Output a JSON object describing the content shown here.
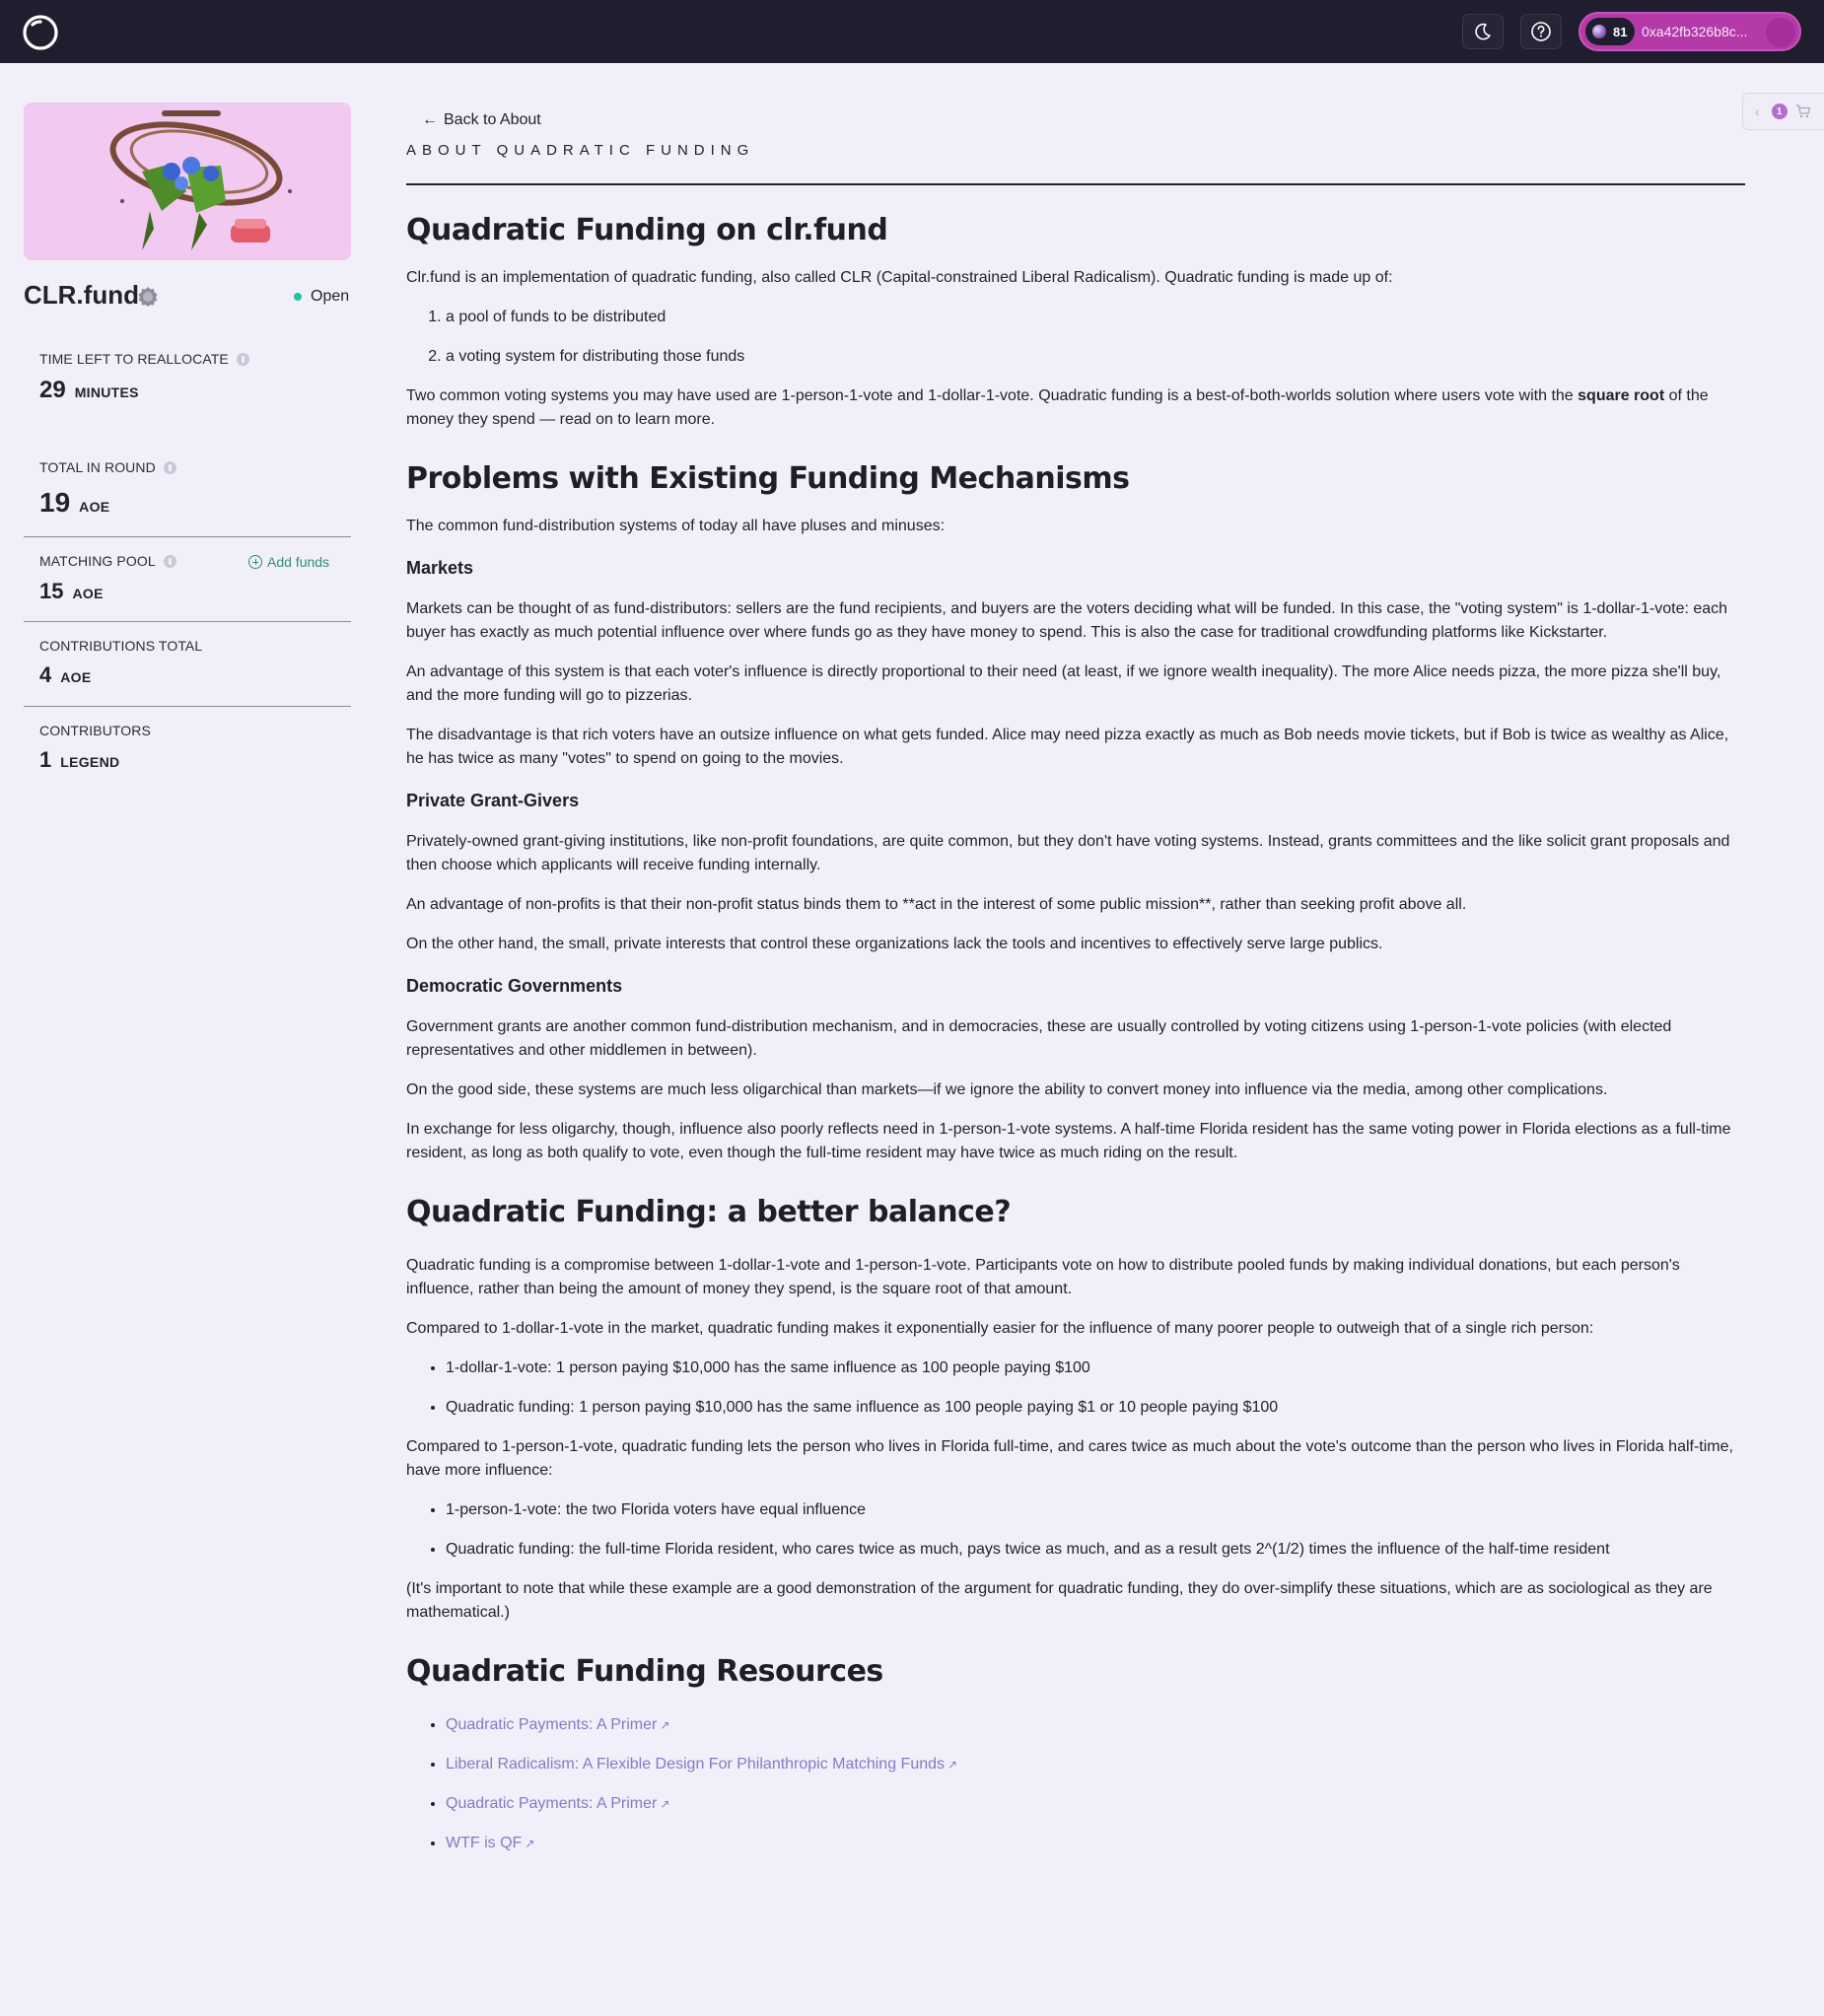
{
  "header": {
    "wallet_count": "81",
    "wallet_address": "0xa42fb326b8c..."
  },
  "sidebar": {
    "round_name": "CLR.fund",
    "status": "Open",
    "stats": {
      "time_left": {
        "label": "TIME LEFT TO REALLOCATE",
        "value": "29",
        "unit": "MINUTES"
      },
      "total_in_round": {
        "label": "TOTAL IN ROUND",
        "value": "19",
        "unit": "AOE"
      },
      "matching_pool": {
        "label": "MATCHING POOL",
        "value": "15",
        "unit": "AOE",
        "action": "Add funds"
      },
      "contributions_total": {
        "label": "CONTRIBUTIONS TOTAL",
        "value": "4",
        "unit": "AOE"
      },
      "contributors": {
        "label": "CONTRIBUTORS",
        "value": "1",
        "unit": "LEGEND"
      }
    }
  },
  "cart": {
    "badge": "1"
  },
  "main": {
    "back_link": "Back to About",
    "eyebrow": "ABOUT QUADRATIC FUNDING",
    "section1": {
      "heading": "Quadratic Funding on clr.fund",
      "intro": "Clr.fund is an implementation of quadratic funding, also called CLR (Capital-constrained Liberal Radicalism). Quadratic funding is made up of:",
      "list": [
        "a pool of funds to be distributed",
        "a voting system for distributing those funds"
      ],
      "p2_before": "Two common voting systems you may have used are 1-person-1-vote and 1-dollar-1-vote. Quadratic funding is a best-of-both-worlds solution where users vote with the ",
      "p2_bold": "square root",
      "p2_after": " of the money they spend — read on to learn more."
    },
    "section2": {
      "heading": "Problems with Existing Funding Mechanisms",
      "intro": "The common fund-distribution systems of today all have pluses and minuses:",
      "markets": {
        "heading": "Markets",
        "p1": "Markets can be thought of as fund-distributors: sellers are the fund recipients, and buyers are the voters deciding what will be funded. In this case, the \"voting system\" is 1-dollar-1-vote: each buyer has exactly as much potential influence over where funds go as they have money to spend. This is also the case for traditional crowdfunding platforms like Kickstarter.",
        "p2": "An advantage of this system is that each voter's influence is directly proportional to their need (at least, if we ignore wealth inequality). The more Alice needs pizza, the more pizza she'll buy, and the more funding will go to pizzerias.",
        "p3": "The disadvantage is that rich voters have an outsize influence on what gets funded. Alice may need pizza exactly as much as Bob needs movie tickets, but if Bob is twice as wealthy as Alice, he has twice as many \"votes\" to spend on going to the movies."
      },
      "private": {
        "heading": "Private Grant-Givers",
        "p1": "Privately-owned grant-giving institutions, like non-profit foundations, are quite common, but they don't have voting systems. Instead, grants committees and the like solicit grant proposals and then choose which applicants will receive funding internally.",
        "p2": "An advantage of non-profits is that their non-profit status binds them to **act in the interest of some public mission**, rather than seeking profit above all.",
        "p3": "On the other hand, the small, private interests that control these organizations lack the tools and incentives to effectively serve large publics."
      },
      "democratic": {
        "heading": "Democratic Governments",
        "p1": "Government grants are another common fund-distribution mechanism, and in democracies, these are usually controlled by voting citizens using 1-person-1-vote policies (with elected representatives and other middlemen in between).",
        "p2": "On the good side, these systems are much less oligarchical than markets—if we ignore the ability to convert money into influence via the media, among other complications.",
        "p3": "In exchange for less oligarchy, though, influence also poorly reflects need in 1-person-1-vote systems. A half-time Florida resident has the same voting power in Florida elections as a full-time resident, as long as both qualify to vote, even though the full-time resident may have twice as much riding on the result."
      }
    },
    "section3": {
      "heading": "Quadratic Funding: a better balance?",
      "p1": "Quadratic funding is a compromise between 1-dollar-1-vote and 1-person-1-vote. Participants vote on how to distribute pooled funds by making individual donations, but each person's influence, rather than being the amount of money they spend, is the square root of that amount.",
      "p2": "Compared to 1-dollar-1-vote in the market, quadratic funding makes it exponentially easier for the influence of many poorer people to outweigh that of a single rich person:",
      "list1": [
        "1-dollar-1-vote: 1 person paying $10,000 has the same influence as 100 people paying $100",
        "Quadratic funding: 1 person paying $10,000 has the same influence as 100 people paying $1 or 10 people paying $100"
      ],
      "p3": "Compared to 1-person-1-vote, quadratic funding lets the person who lives in Florida full-time, and cares twice as much about the vote's outcome than the person who lives in Florida half-time, have more influence:",
      "list2": [
        "1-person-1-vote: the two Florida voters have equal influence",
        "Quadratic funding: the full-time Florida resident, who cares twice as much, pays twice as much, and as a result gets 2^(1/2) times the influence of the half-time resident"
      ],
      "p4": "(It's important to note that while these example are a good demonstration of the argument for quadratic funding, they do over-simplify these situations, which are as sociological as they are mathematical.)"
    },
    "section4": {
      "heading": "Quadratic Funding Resources",
      "links": [
        "Quadratic Payments: A Primer",
        "Liberal Radicalism: A Flexible Design For Philanthropic Matching Funds",
        "Quadratic Payments: A Primer",
        "WTF is QF"
      ]
    }
  }
}
